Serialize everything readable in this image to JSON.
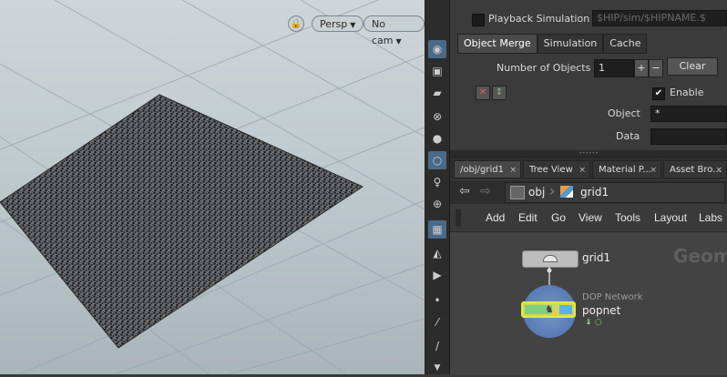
{
  "viewport": {
    "camera_mode": "Persp",
    "camera": "No cam"
  },
  "params": {
    "playback_label": "Playback Simulation",
    "playback_path": "$HIP/sim/$HIPNAME.$",
    "tabs": [
      "Object Merge",
      "Simulation",
      "Cache"
    ],
    "active_tab": "Object Merge",
    "num_objects_label": "Number of Objects",
    "num_objects_value": "1",
    "plus": "+",
    "minus": "−",
    "clear_label": "Clear",
    "enable_label": "Enable",
    "object_label": "Object",
    "object_value": "*",
    "data_label": "Data",
    "data_value": ""
  },
  "network": {
    "tabs": [
      {
        "label": "/obj/grid1",
        "close": "×"
      },
      {
        "label": "Tree View",
        "close": "×"
      },
      {
        "label": "Material P...",
        "close": "×"
      },
      {
        "label": "Asset Bro...",
        "close": "×"
      }
    ],
    "path": [
      "obj",
      "grid1"
    ],
    "menus": [
      "Add",
      "Edit",
      "Go",
      "View",
      "Tools",
      "Layout",
      "Labs"
    ],
    "context_label": "Geom",
    "nodes": [
      {
        "name": "grid1",
        "type": ""
      },
      {
        "name": "popnet",
        "type": "DOP Network"
      }
    ]
  },
  "colors": {
    "accent_active": "#4a6a86",
    "node_selected": "#e6e64a",
    "dop_node": "#5d7fb8"
  }
}
